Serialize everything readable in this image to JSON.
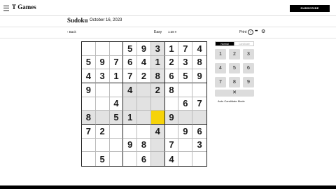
{
  "header": {
    "brand": "Т Games",
    "subscribe": "SUBSCRIBE"
  },
  "titlebar": {
    "title": "Sudoku",
    "date": "October 16, 2023"
  },
  "toolbar": {
    "back": "‹ Back",
    "difficulty": "Easy",
    "timer": "1:38 ⏸",
    "print": "Print",
    "help": "?",
    "more": "•••",
    "settings": "⚙"
  },
  "board": {
    "rows": [
      [
        "",
        "",
        "",
        "5",
        "9",
        "3",
        "1",
        "7",
        "4"
      ],
      [
        "5",
        "9",
        "7",
        "6",
        "4",
        "1",
        "2",
        "3",
        "8"
      ],
      [
        "4",
        "3",
        "1",
        "7",
        "2",
        "8",
        "6",
        "5",
        "9"
      ],
      [
        "9",
        "",
        "",
        "4",
        "",
        "2",
        "8",
        "",
        ""
      ],
      [
        "",
        "",
        "4",
        "",
        "",
        "",
        "",
        "6",
        "7"
      ],
      [
        "8",
        "",
        "5",
        "1",
        "",
        "",
        "9",
        "",
        ""
      ],
      [
        "7",
        "2",
        "",
        "",
        "",
        "4",
        "",
        "9",
        "6"
      ],
      [
        "",
        "",
        "",
        "9",
        "8",
        "",
        "7",
        "",
        "3"
      ],
      [
        "",
        "5",
        "",
        "",
        "6",
        "",
        "4",
        "",
        ""
      ]
    ],
    "selected": [
      5,
      5
    ],
    "highlight_color": "#e2e2e2",
    "selected_color": "#f6d309"
  },
  "controls": {
    "mode_normal": "Normal",
    "mode_candidate": "Candidate",
    "keys": [
      "1",
      "2",
      "3",
      "4",
      "5",
      "6",
      "7",
      "8",
      "9"
    ],
    "erase": "✕",
    "auto_candidate": "Auto Candidate Mode"
  }
}
